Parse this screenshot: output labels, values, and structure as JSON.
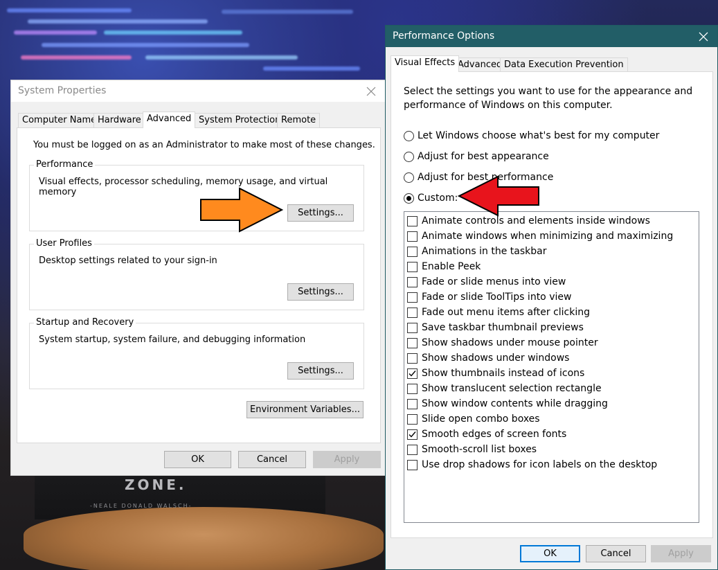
{
  "background": {
    "mug_text": "ZONE.",
    "mug_subtext": "-NEALE DONALD WALSCH-"
  },
  "system_properties": {
    "title": "System Properties",
    "tabs": [
      {
        "label": "Computer Name",
        "active": false
      },
      {
        "label": "Hardware",
        "active": false
      },
      {
        "label": "Advanced",
        "active": true
      },
      {
        "label": "System Protection",
        "active": false
      },
      {
        "label": "Remote",
        "active": false
      }
    ],
    "admin_note": "You must be logged on as an Administrator to make most of these changes.",
    "groups": [
      {
        "label": "Performance",
        "description": "Visual effects, processor scheduling, memory usage, and virtual memory",
        "button": "Settings..."
      },
      {
        "label": "User Profiles",
        "description": "Desktop settings related to your sign-in",
        "button": "Settings..."
      },
      {
        "label": "Startup and Recovery",
        "description": "System startup, system failure, and debugging information",
        "button": "Settings..."
      }
    ],
    "env_button": "Environment Variables...",
    "ok": "OK",
    "cancel": "Cancel",
    "apply": "Apply"
  },
  "performance_options": {
    "title": "Performance Options",
    "close_glyph": "✕",
    "tabs": [
      {
        "label": "Visual Effects",
        "active": true
      },
      {
        "label": "Advanced",
        "active": false
      },
      {
        "label": "Data Execution Prevention",
        "active": false
      }
    ],
    "intro_line1": "Select the settings you want to use for the appearance and",
    "intro_line2": "performance of Windows on this computer.",
    "radios": [
      {
        "label": "Let Windows choose what's best for my computer",
        "selected": false
      },
      {
        "label": "Adjust for best appearance",
        "selected": false
      },
      {
        "label": "Adjust for best performance",
        "selected": false
      },
      {
        "label": "Custom:",
        "selected": true
      }
    ],
    "effects": [
      {
        "label": "Animate controls and elements inside windows",
        "checked": false
      },
      {
        "label": "Animate windows when minimizing and maximizing",
        "checked": false
      },
      {
        "label": "Animations in the taskbar",
        "checked": false
      },
      {
        "label": "Enable Peek",
        "checked": false
      },
      {
        "label": "Fade or slide menus into view",
        "checked": false
      },
      {
        "label": "Fade or slide ToolTips into view",
        "checked": false
      },
      {
        "label": "Fade out menu items after clicking",
        "checked": false
      },
      {
        "label": "Save taskbar thumbnail previews",
        "checked": false
      },
      {
        "label": "Show shadows under mouse pointer",
        "checked": false
      },
      {
        "label": "Show shadows under windows",
        "checked": false
      },
      {
        "label": "Show thumbnails instead of icons",
        "checked": true
      },
      {
        "label": "Show translucent selection rectangle",
        "checked": false
      },
      {
        "label": "Show window contents while dragging",
        "checked": false
      },
      {
        "label": "Slide open combo boxes",
        "checked": false
      },
      {
        "label": "Smooth edges of screen fonts",
        "checked": true
      },
      {
        "label": "Smooth-scroll list boxes",
        "checked": false
      },
      {
        "label": "Use drop shadows for icon labels on the desktop",
        "checked": false
      }
    ],
    "ok": "OK",
    "cancel": "Cancel",
    "apply": "Apply"
  },
  "colors": {
    "perf_titlebar": "#225e67",
    "orange_arrow": "#ff8a1e",
    "red_arrow": "#e8141c",
    "default_button_border": "#0078d7"
  },
  "icons": {
    "close": "close-icon",
    "check": "check-icon",
    "orange_arrow": "arrow-right-icon",
    "red_arrow": "arrow-left-icon"
  }
}
